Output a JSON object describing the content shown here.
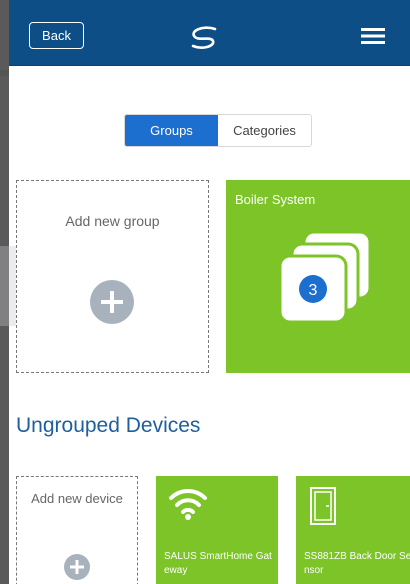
{
  "header": {
    "back_label": "Back",
    "logo_icon": "salus-s-logo-icon",
    "menu_icon": "hamburger-menu-icon",
    "background_color": "#0e4e86"
  },
  "tabs": {
    "groups_label": "Groups",
    "categories_label": "Categories",
    "active": "Groups",
    "accent_color": "#1d6fcf"
  },
  "groups": {
    "add_label": "Add new group",
    "items": [
      {
        "name": "Boiler System",
        "count": "3"
      }
    ],
    "tile_color": "#7cc428"
  },
  "ungrouped": {
    "title": "Ungrouped Devices",
    "add_label": "Add new device",
    "devices": [
      {
        "name": "SALUS SmartHome Gateway",
        "icon": "wifi-icon"
      },
      {
        "name": "SS881ZB Back Door Sensor",
        "icon": "door-icon"
      }
    ]
  }
}
